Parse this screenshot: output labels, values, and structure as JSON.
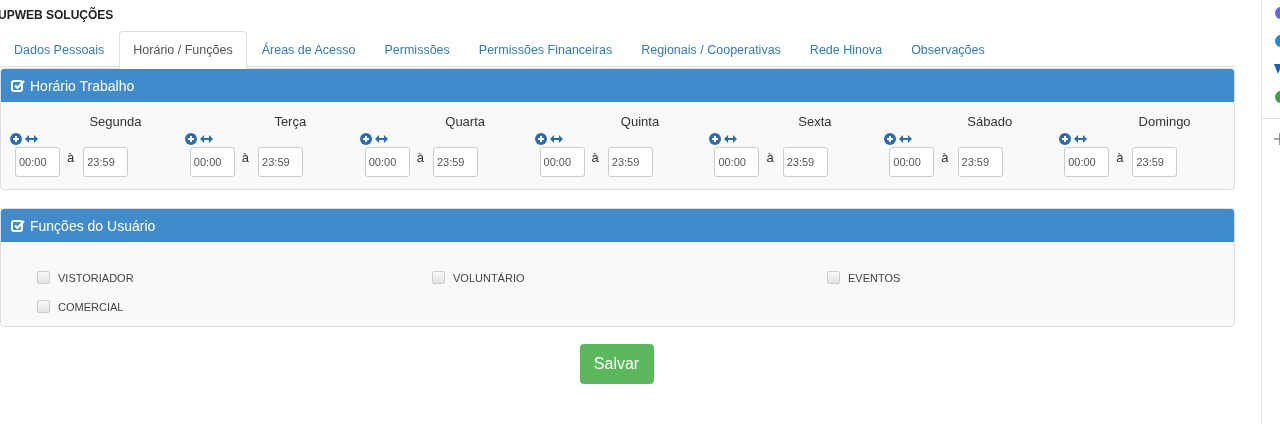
{
  "title": "UPWEB SOLUÇÕES",
  "tabs": [
    {
      "label": "Dados Pessoais",
      "selected": false
    },
    {
      "label": "Horário / Funções",
      "selected": true
    },
    {
      "label": "Áreas de Acesso",
      "selected": false
    },
    {
      "label": "Permissões",
      "selected": false
    },
    {
      "label": "Permissões Financeiras",
      "selected": false
    },
    {
      "label": "Regionais / Cooperativas",
      "selected": false
    },
    {
      "label": "Rede Hinova",
      "selected": false
    },
    {
      "label": "Observações",
      "selected": false
    }
  ],
  "schedule": {
    "title": "Horário Trabalho",
    "days": [
      {
        "name": "Segunda",
        "start": "00:00",
        "separator": "à",
        "end": "23:59"
      },
      {
        "name": "Terça",
        "start": "00:00",
        "separator": "à",
        "end": "23:59"
      },
      {
        "name": "Quarta",
        "start": "00:00",
        "separator": "à",
        "end": "23:59"
      },
      {
        "name": "Quinta",
        "start": "00:00",
        "separator": "à",
        "end": "23:59"
      },
      {
        "name": "Sexta",
        "start": "00:00",
        "separator": "à",
        "end": "23:59"
      },
      {
        "name": "Sábado",
        "start": "00:00",
        "separator": "à",
        "end": "23:59"
      },
      {
        "name": "Domingo",
        "start": "00:00",
        "separator": "à",
        "end": "23:59"
      }
    ]
  },
  "functions": {
    "title": "Funções do Usuário",
    "items": [
      {
        "label": "VISTORIADOR",
        "checked": false
      },
      {
        "label": "VOLUNTÁRIO",
        "checked": false
      },
      {
        "label": "EVENTOS",
        "checked": false
      },
      {
        "label": "COMERCIAL",
        "checked": false
      }
    ]
  },
  "save_button": "Salvar"
}
